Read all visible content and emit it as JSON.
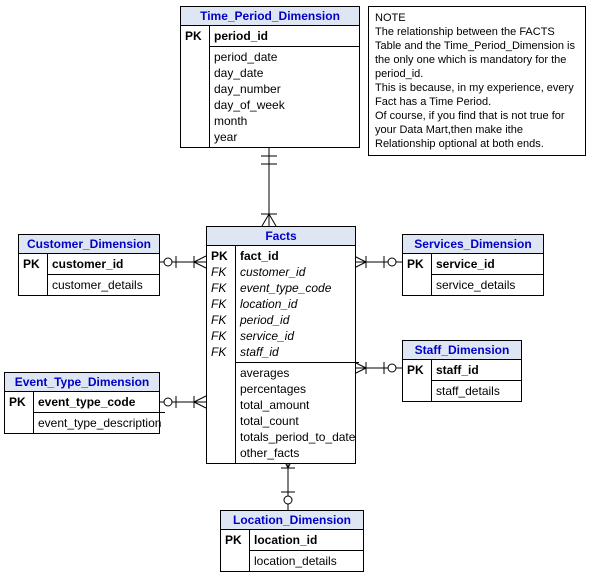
{
  "note": {
    "title": "NOTE",
    "line1": "The relationship between the FACTS Table and the Time_Period_Dimension is the only one which is mandatory for the period_id.",
    "line2": "This is because, in my experience, every Fact has a Time Period.",
    "line3": "Of course, if you find that is not true for your Data Mart,then make ithe Relationship optional at both ends."
  },
  "entities": {
    "time": {
      "title": "Time_Period_Dimension",
      "pk_label": "PK",
      "pk": "period_id",
      "a1": "period_date",
      "a2": "day_date",
      "a3": "day_number",
      "a4": "day_of_week",
      "a5": "month",
      "a6": "year"
    },
    "customer": {
      "title": "Customer_Dimension",
      "pk_label": "PK",
      "pk": "customer_id",
      "a1": "customer_details"
    },
    "event": {
      "title": "Event_Type_Dimension",
      "pk_label": "PK",
      "pk": "event_type_code",
      "a1": "event_type_description"
    },
    "facts": {
      "title": "Facts",
      "pk_label": "PK",
      "fk_label": "FK",
      "pk": "fact_id",
      "f1": "customer_id",
      "f2": "event_type_code",
      "f3": "location_id",
      "f4": "period_id",
      "f5": "service_id",
      "f6": "staff_id",
      "a1": "averages",
      "a2": "percentages",
      "a3": "total_amount",
      "a4": "total_count",
      "a5": "totals_period_to_date",
      "a6": "other_facts"
    },
    "services": {
      "title": "Services_Dimension",
      "pk_label": "PK",
      "pk": "service_id",
      "a1": "service_details"
    },
    "staff": {
      "title": "Staff_Dimension",
      "pk_label": "PK",
      "pk": "staff_id",
      "a1": "staff_details"
    },
    "location": {
      "title": "Location_Dimension",
      "pk_label": "PK",
      "pk": "location_id",
      "a1": "location_details"
    }
  },
  "chart_data": {
    "type": "er-diagram",
    "entities": [
      {
        "name": "Time_Period_Dimension",
        "pk": [
          "period_id"
        ],
        "attrs": [
          "period_date",
          "day_date",
          "day_number",
          "day_of_week",
          "month",
          "year"
        ]
      },
      {
        "name": "Customer_Dimension",
        "pk": [
          "customer_id"
        ],
        "attrs": [
          "customer_details"
        ]
      },
      {
        "name": "Event_Type_Dimension",
        "pk": [
          "event_type_code"
        ],
        "attrs": [
          "event_type_description"
        ]
      },
      {
        "name": "Services_Dimension",
        "pk": [
          "service_id"
        ],
        "attrs": [
          "service_details"
        ]
      },
      {
        "name": "Staff_Dimension",
        "pk": [
          "staff_id"
        ],
        "attrs": [
          "staff_details"
        ]
      },
      {
        "name": "Location_Dimension",
        "pk": [
          "location_id"
        ],
        "attrs": [
          "location_details"
        ]
      },
      {
        "name": "Facts",
        "pk": [
          "fact_id"
        ],
        "fk": [
          "customer_id",
          "event_type_code",
          "location_id",
          "period_id",
          "service_id",
          "staff_id"
        ],
        "attrs": [
          "averages",
          "percentages",
          "total_amount",
          "total_count",
          "totals_period_to_date",
          "other_facts"
        ]
      }
    ],
    "relationships": [
      {
        "from": "Facts",
        "to": "Time_Period_Dimension",
        "mandatory": true
      },
      {
        "from": "Facts",
        "to": "Customer_Dimension",
        "mandatory": false
      },
      {
        "from": "Facts",
        "to": "Event_Type_Dimension",
        "mandatory": false
      },
      {
        "from": "Facts",
        "to": "Services_Dimension",
        "mandatory": false
      },
      {
        "from": "Facts",
        "to": "Staff_Dimension",
        "mandatory": false
      },
      {
        "from": "Facts",
        "to": "Location_Dimension",
        "mandatory": false
      }
    ]
  }
}
